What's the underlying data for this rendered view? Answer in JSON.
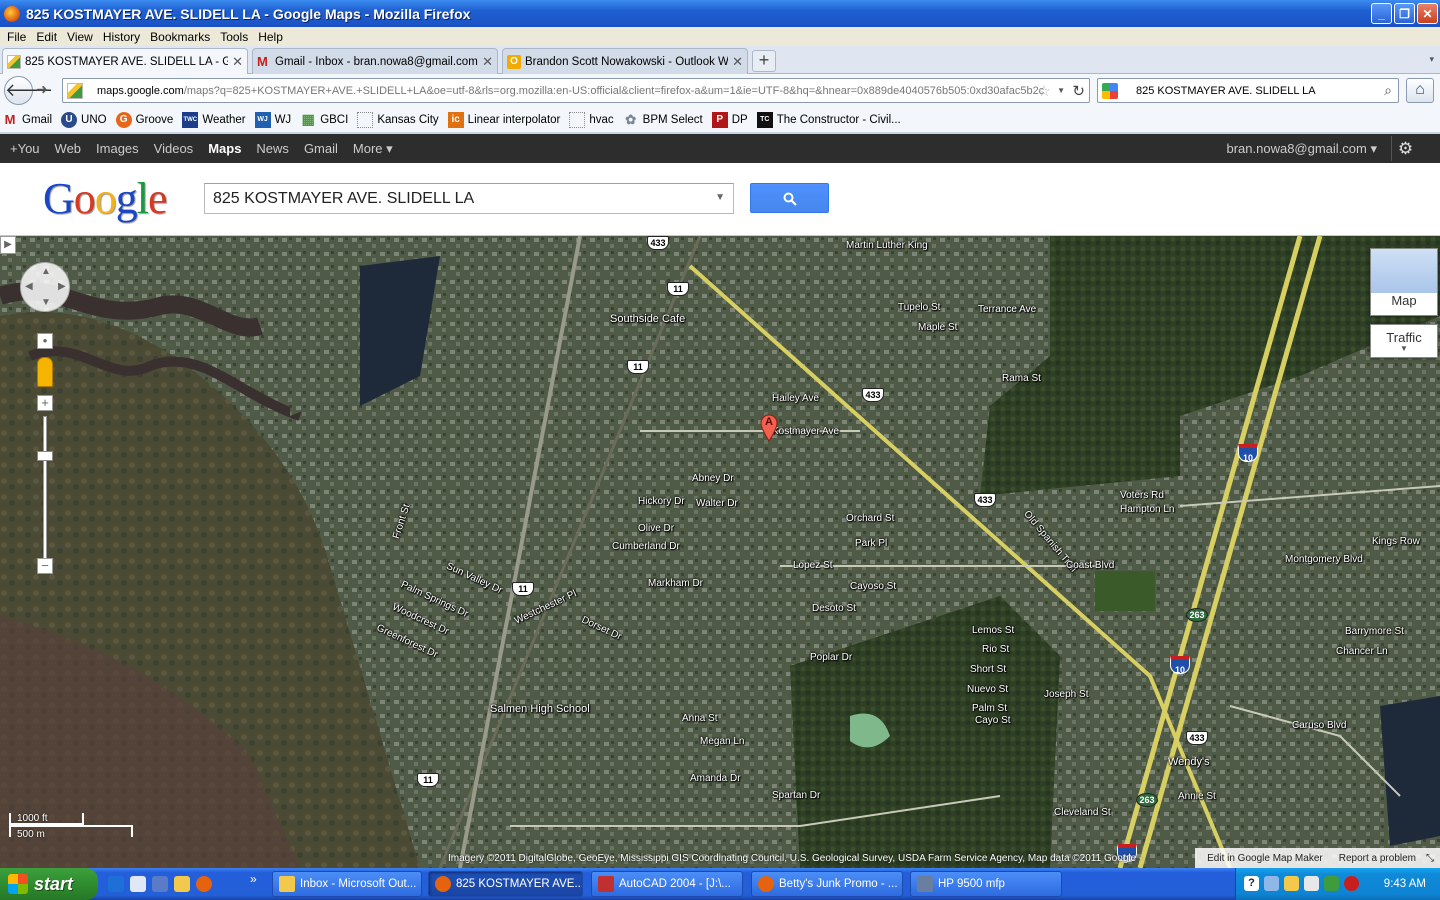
{
  "window": {
    "title": "825 KOSTMAYER AVE. SLIDELL LA - Google Maps - Mozilla Firefox",
    "minimize": "_",
    "restore": "❐",
    "close": "✕"
  },
  "menu": [
    "File",
    "Edit",
    "View",
    "History",
    "Bookmarks",
    "Tools",
    "Help"
  ],
  "tabs": [
    {
      "label": "825 KOSTMAYER AVE. SLIDELL LA - Goog...",
      "active": true
    },
    {
      "label": "Gmail - Inbox - bran.nowa8@gmail.com",
      "active": false
    },
    {
      "label": "Brandon Scott Nowakowski - Outlook We...",
      "active": false
    }
  ],
  "nav": {
    "url_domain": "maps.google.com",
    "url_rest": "/maps?q=825+KOSTMAYER+AVE.+SLIDELL+LA&oe=utf-8&rls=org.mozilla:en-US:official&client=firefox-a&um=1&ie=UTF-8&hq=&hnear=0x889de4040576b505:0xd30afac5b2c",
    "search_value": "825 KOSTMAYER AVE. SLIDELL LA"
  },
  "bookmarks": [
    {
      "label": "Gmail",
      "color": "#c5221f",
      "glyph": "M"
    },
    {
      "label": "UNO",
      "color": "#2a4a8a",
      "glyph": "U"
    },
    {
      "label": "Groove",
      "color": "#e8661a",
      "glyph": "G"
    },
    {
      "label": "Weather",
      "color": "#1a3e8c",
      "glyph": "TWC"
    },
    {
      "label": "WJ",
      "color": "#2060b0",
      "glyph": "WJ"
    },
    {
      "label": "GBCI",
      "color": "#4a9a3a",
      "glyph": "▦"
    },
    {
      "label": "Kansas City",
      "color": "#ffffff",
      "glyph": ""
    },
    {
      "label": "Linear interpolator",
      "color": "#e07010",
      "glyph": "ic"
    },
    {
      "label": "hvac",
      "color": "#ffffff",
      "glyph": ""
    },
    {
      "label": "BPM Select",
      "color": "#9aa7b8",
      "glyph": "✿"
    },
    {
      "label": "DP",
      "color": "#b01818",
      "glyph": "P"
    },
    {
      "label": "The Constructor - Civil...",
      "color": "#111111",
      "glyph": "TC"
    }
  ],
  "gbar": {
    "items": [
      {
        "label": "+You",
        "active": false
      },
      {
        "label": "Web",
        "active": false
      },
      {
        "label": "Images",
        "active": false
      },
      {
        "label": "Videos",
        "active": false
      },
      {
        "label": "Maps",
        "active": true
      },
      {
        "label": "News",
        "active": false
      },
      {
        "label": "Gmail",
        "active": false
      },
      {
        "label": "More ▾",
        "active": false
      }
    ],
    "user": "bran.nowa8@gmail.com ▾"
  },
  "search": {
    "query": "825 KOSTMAYER AVE. SLIDELL LA"
  },
  "map": {
    "marker_label": "A",
    "map_button": "Map",
    "traffic_button": "Traffic",
    "scale_ft": "1000 ft",
    "scale_m": "500 m",
    "attribution": "Imagery ©2011 DigitalGlobe, GeoEye, Mississippi GIS Coordinating Council, U.S. Geological Survey, USDA Farm Service Agency, Map data ©2011 Google -",
    "edit_link": "Edit in Google Map Maker",
    "report_link": "Report a problem",
    "street_labels": [
      "Kostmayer Ave",
      "Hailey Ave",
      "Abney Dr",
      "Walter Dr",
      "Hickory Dr",
      "Olive Dr",
      "Cumberland Dr",
      "Markham Dr",
      "Lopez St",
      "Desoto St",
      "Poplar Dr",
      "Orchard St",
      "Park Pl",
      "Cayoso St",
      "Rama St",
      "Tupelo St",
      "Maple St",
      "Terrance Ave",
      "Martin Luther King",
      "Old Spanish Trail",
      "Coast Blvd",
      "Voters Rd",
      "Hampton Ln",
      "Montgomery Blvd",
      "Kings Row",
      "Barrymore St",
      "Chancer Ln",
      "Caruso Blvd",
      "Spartan Dr",
      "Anna St",
      "Megan Ln",
      "Amanda Dr",
      "Cleveland St",
      "Annie St",
      "Joseph St",
      "Short St",
      "Nuevo St",
      "Palm St",
      "Cayo St",
      "Lemos St",
      "Rio St",
      "Sun Valley Dr",
      "Palm Springs Dr",
      "Westchester Pl",
      "Dorset Dr",
      "Greenforest Dr",
      "Woodcrest Dr",
      "Front St",
      "Salmen High School",
      "Southside Cafe",
      "Wendy's"
    ],
    "shields_us": [
      "433",
      "11",
      "11",
      "433",
      "433",
      "11",
      "11",
      "433"
    ],
    "shields_i": [
      "10",
      "10",
      "10"
    ],
    "shields_state": [
      "263",
      "263"
    ]
  },
  "taskbar": {
    "start": "start",
    "buttons": [
      {
        "label": "Inbox - Microsoft Out...",
        "active": false,
        "color": "#f2c94c"
      },
      {
        "label": "825 KOSTMAYER AVE....",
        "active": true,
        "color": "#e5620e"
      },
      {
        "label": "AutoCAD 2004 - [J:\\...",
        "active": false,
        "color": "#c03030"
      },
      {
        "label": "Betty's Junk Promo - ...",
        "active": false,
        "color": "#e5620e"
      },
      {
        "label": "HP 9500 mfp",
        "active": false,
        "color": "#6a7fa0"
      }
    ],
    "clock": "9:43 AM"
  }
}
